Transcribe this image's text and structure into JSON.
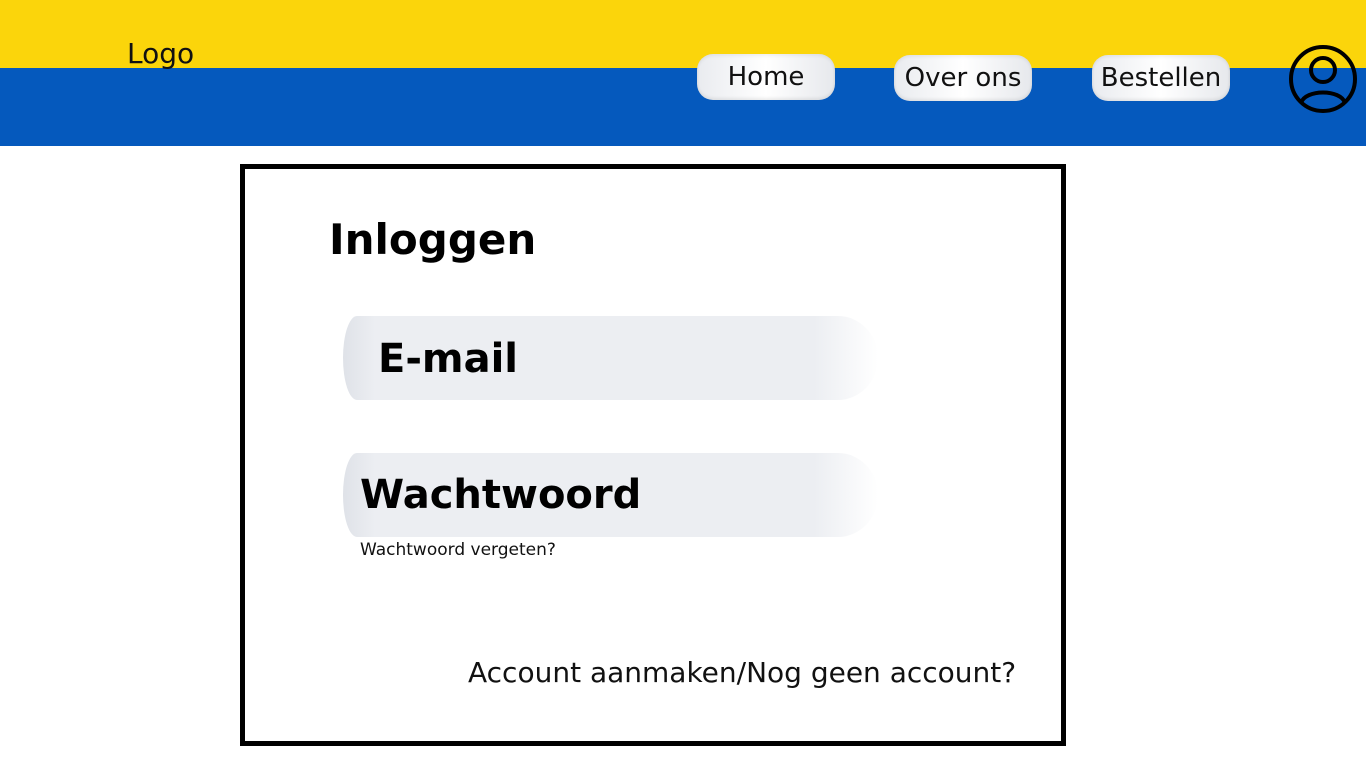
{
  "header": {
    "logo_text": "Logo",
    "colors": {
      "top_band": "#fbd50b",
      "bottom_band": "#0559bd"
    },
    "nav": {
      "home_label": "Home",
      "about_label": "Over ons",
      "order_label": "Bestellen"
    },
    "profile_icon": "user-profile-icon"
  },
  "login": {
    "title": "Inloggen",
    "email_placeholder": "E-mail",
    "password_placeholder": "Wachtwoord",
    "forgot_password": "Wachtwoord vergeten?",
    "create_account": "Account aanmaken/Nog geen account?"
  }
}
